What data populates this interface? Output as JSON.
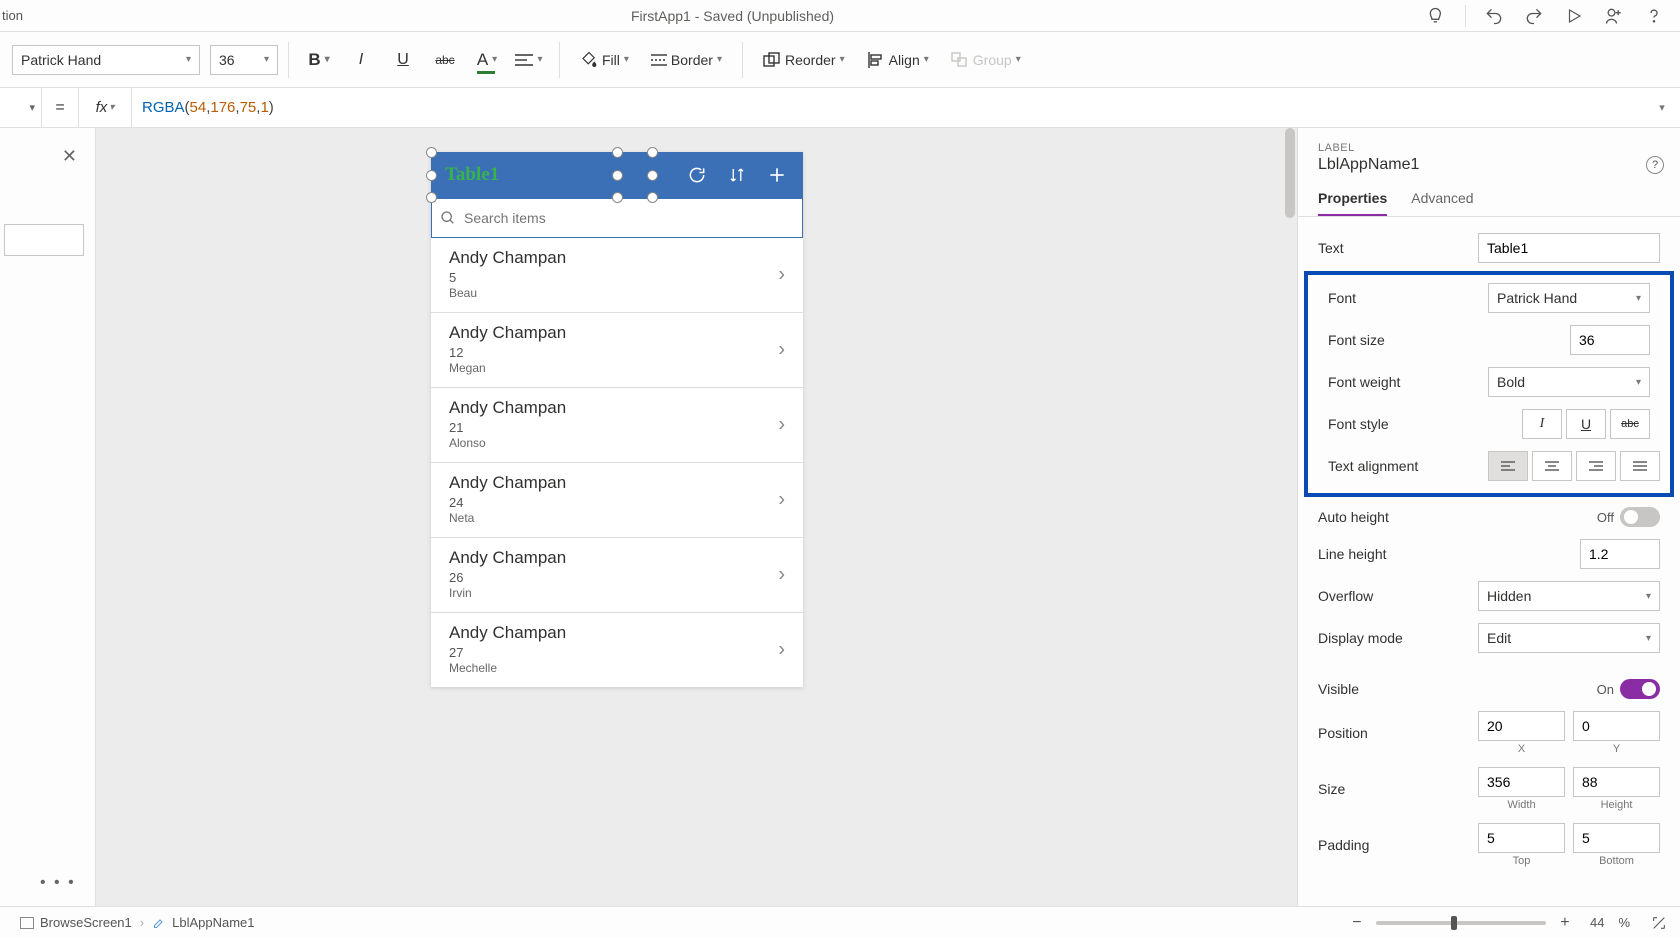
{
  "titlebar": {
    "left_fragment": "tion",
    "center": "FirstApp1 - Saved (Unpublished)"
  },
  "ribbon": {
    "font": "Patrick Hand",
    "font_size": "36",
    "bold_label": "B",
    "italic_label": "I",
    "underline_label": "U",
    "strike_label": "abc",
    "fontcolor_label": "A",
    "fill_label": "Fill",
    "border_label": "Border",
    "reorder_label": "Reorder",
    "align_label": "Align",
    "group_label": "Group"
  },
  "formula": {
    "eq": "=",
    "fx": "fx",
    "fn": "RGBA",
    "args": [
      "54",
      "176",
      "75",
      "1"
    ]
  },
  "canvas": {
    "app_title": "Table1",
    "search_placeholder": "Search items",
    "items": [
      {
        "name": "Andy Champan",
        "line2": "5",
        "line3": "Beau"
      },
      {
        "name": "Andy Champan",
        "line2": "12",
        "line3": "Megan"
      },
      {
        "name": "Andy Champan",
        "line2": "21",
        "line3": "Alonso"
      },
      {
        "name": "Andy Champan",
        "line2": "24",
        "line3": "Neta"
      },
      {
        "name": "Andy Champan",
        "line2": "26",
        "line3": "Irvin"
      },
      {
        "name": "Andy Champan",
        "line2": "27",
        "line3": "Mechelle"
      }
    ]
  },
  "props": {
    "type": "LABEL",
    "name": "LblAppName1",
    "tabs": {
      "properties": "Properties",
      "advanced": "Advanced"
    },
    "rows": {
      "text": {
        "label": "Text",
        "value": "Table1"
      },
      "font": {
        "label": "Font",
        "value": "Patrick Hand"
      },
      "font_size": {
        "label": "Font size",
        "value": "36"
      },
      "font_weight": {
        "label": "Font weight",
        "value": "Bold"
      },
      "font_style": {
        "label": "Font style"
      },
      "text_align": {
        "label": "Text alignment"
      },
      "auto_height": {
        "label": "Auto height",
        "state": "Off"
      },
      "line_height": {
        "label": "Line height",
        "value": "1.2"
      },
      "overflow": {
        "label": "Overflow",
        "value": "Hidden"
      },
      "display_mode": {
        "label": "Display mode",
        "value": "Edit"
      },
      "visible": {
        "label": "Visible",
        "state": "On"
      },
      "position": {
        "label": "Position",
        "x": "20",
        "y": "0",
        "xlbl": "X",
        "ylbl": "Y"
      },
      "size": {
        "label": "Size",
        "w": "356",
        "h": "88",
        "wlbl": "Width",
        "hlbl": "Height"
      },
      "padding": {
        "label": "Padding",
        "t": "5",
        "b": "5",
        "tlbl": "Top",
        "blbl": "Bottom"
      }
    }
  },
  "statusbar": {
    "crumb1": "BrowseScreen1",
    "crumb2": "LblAppName1",
    "zoom_value": "44",
    "zoom_pct": "%"
  }
}
